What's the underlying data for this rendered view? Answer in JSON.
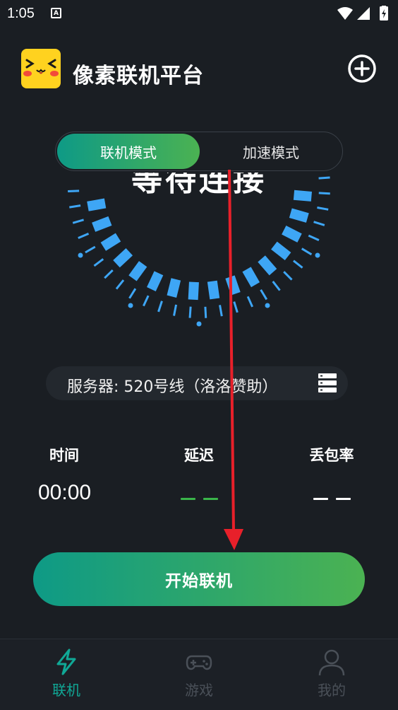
{
  "status_bar": {
    "time": "1:05",
    "notification_icon": "A",
    "icons": [
      "wifi-icon",
      "signal-icon",
      "battery-charging-icon"
    ]
  },
  "header": {
    "app_title": "像素联机平台",
    "logo_icon": "pikachu-face-logo",
    "add_icon": "plus-circle-icon"
  },
  "mode_toggle": {
    "active_tab": "联机模式",
    "inactive_tab": "加速模式"
  },
  "dial": {
    "status_text": "等待连接",
    "accent_color": "#3ea6f5"
  },
  "server": {
    "label": "服务器:  520号线（洛洛赞助）",
    "icon": "server-list-icon"
  },
  "stats": {
    "time_label": "时间",
    "time_value": "00:00",
    "delay_label": "延迟",
    "delay_value": "— —",
    "loss_label": "丢包率",
    "loss_value": "— —"
  },
  "start_button": {
    "label": "开始联机"
  },
  "bottom_nav": {
    "items": [
      {
        "label": "联机",
        "icon": "lightning-icon",
        "active": true
      },
      {
        "label": "游戏",
        "icon": "gamepad-icon",
        "active": false
      },
      {
        "label": "我的",
        "icon": "user-icon",
        "active": false
      }
    ]
  },
  "colors": {
    "background": "#1a1e23",
    "accent_start": "#0e9a86",
    "accent_end": "#4bb252",
    "annotation_arrow": "#e8202a",
    "nav_active": "#10a896",
    "nav_inactive": "#4a5058"
  }
}
